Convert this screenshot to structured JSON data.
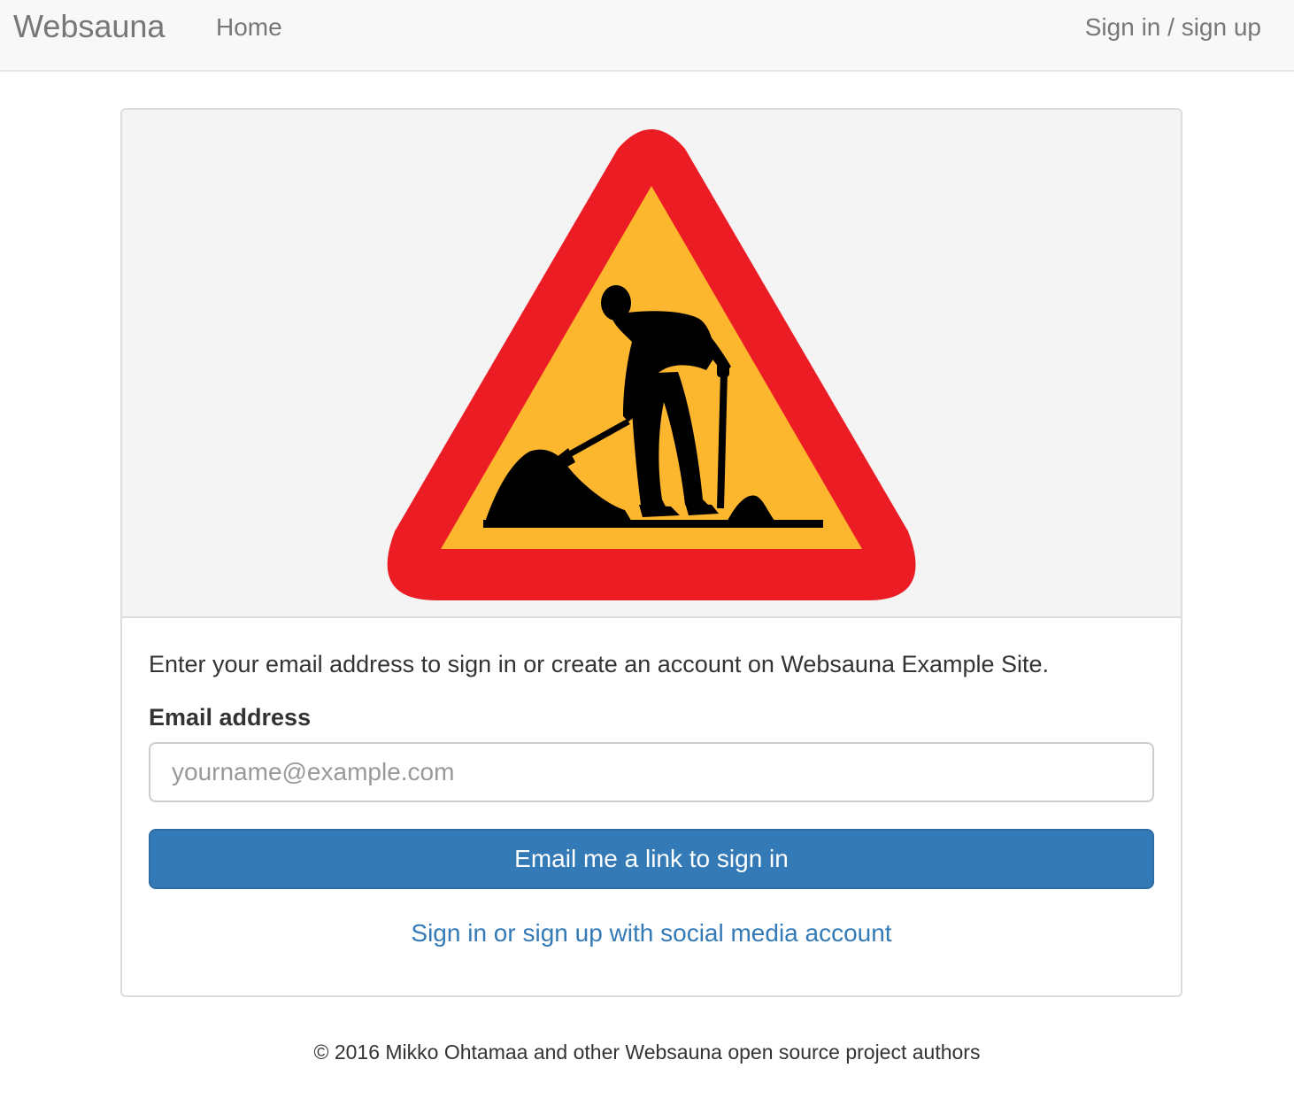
{
  "navbar": {
    "brand": "Websauna",
    "home": "Home",
    "signin": "Sign in / sign up"
  },
  "hero": {
    "icon": "roadwork-warning-sign-icon"
  },
  "login": {
    "intro": "Enter your email address to sign in or create an account on Websauna Example Site.",
    "email_label": "Email address",
    "email_placeholder": "yourname@example.com",
    "email_value": "",
    "submit_label": "Email me a link to sign in",
    "social_link": "Sign in or sign up with social media account"
  },
  "footer": {
    "copyright": "© 2016 Mikko Ohtamaa and other Websauna open source project authors"
  },
  "colors": {
    "primary": "#337ab7",
    "sign_red": "#ec1c24",
    "sign_yellow": "#fdb72f"
  }
}
